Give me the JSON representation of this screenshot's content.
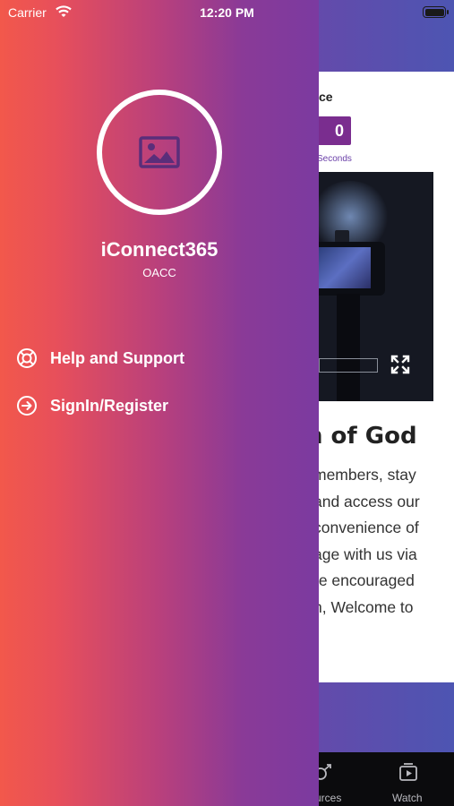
{
  "status_bar": {
    "carrier": "Carrier",
    "time": "12:20 PM",
    "wifi_icon": "wifi-icon",
    "battery_icon": "battery-icon"
  },
  "drawer": {
    "avatar_icon": "image-placeholder-icon",
    "app_name": "iConnect365",
    "org_name": "OACC",
    "menu": [
      {
        "label": "Help and Support",
        "icon": "lifebuoy-icon"
      },
      {
        "label": "SignIn/Register",
        "icon": "sign-in-icon"
      }
    ]
  },
  "main": {
    "countdown": {
      "title_fragment": "ce",
      "digit_value": "0",
      "unit_label": "Seconds"
    },
    "video": {
      "fullscreen_icon": "fullscreen-icon"
    },
    "section_title_fragment": "n of God",
    "paragraph_lines": "members, stay\nand access our\nconvenience of\nage with us via\nre encouraged\nn, Welcome to"
  },
  "tab_bar": {
    "tabs": [
      {
        "label": "urces",
        "icon": "resources-icon"
      },
      {
        "label": "Watch",
        "icon": "watch-icon"
      }
    ]
  },
  "colors": {
    "drawer_gradient_start": "#f2584b",
    "drawer_gradient_end": "#7b3aa0",
    "countdown_box": "#7a2d8f",
    "tab_bar": "#0b0b0d"
  }
}
